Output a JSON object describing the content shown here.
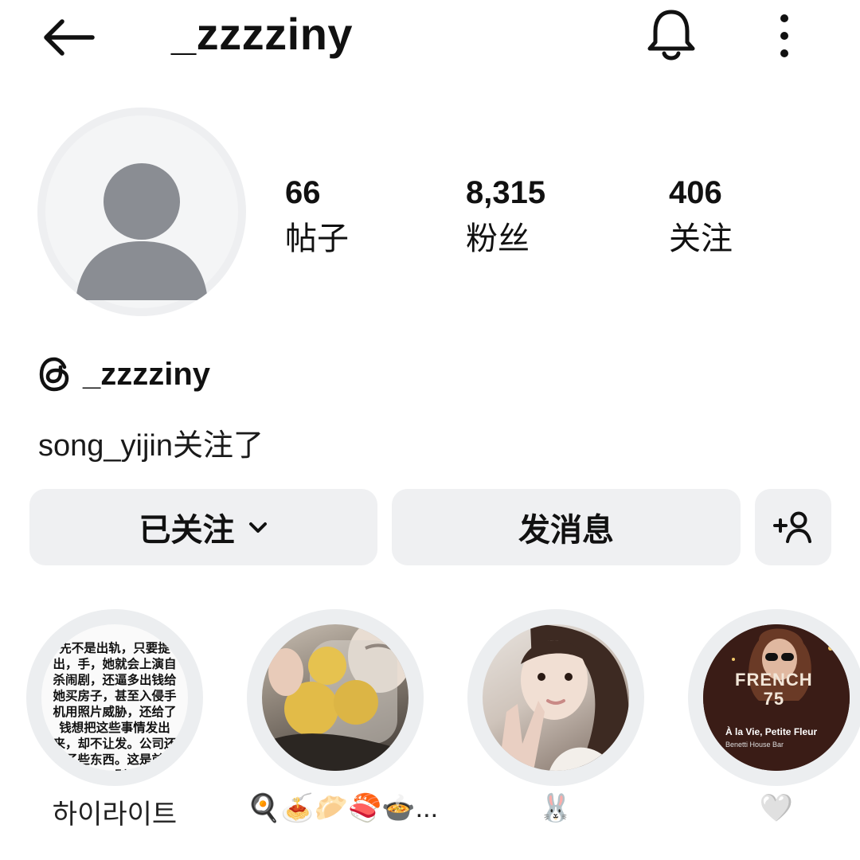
{
  "header": {
    "username": "_zzzziny",
    "back_icon": "arrow-left-icon",
    "bell_icon": "bell-icon",
    "more_icon": "more-vertical-icon"
  },
  "stats": {
    "posts": {
      "value": "66",
      "label": "帖子"
    },
    "followers": {
      "value": "8,315",
      "label": "粉丝"
    },
    "following": {
      "value": "406",
      "label": "关注"
    }
  },
  "threads": {
    "handle": "_zzzziny",
    "icon": "threads-icon"
  },
  "followed_by_text": "song_yijin关注了",
  "actions": {
    "following_label": "已关注",
    "message_label": "发消息",
    "add_user_icon": "add-user-icon"
  },
  "highlights": [
    {
      "caption": "하이라이트",
      "cover_text": "先不是出轨，只要提出，手，她就会上演自杀闹剧，还逼多出钱给她买房子，甚至入侵手机用照片威胁，还给了钱想把这些事情发出来，却不让发。公司还删了些东西。这是前女友的事情。别再对我性骚扰的话或者侮辱人的话。"
    },
    {
      "caption": "🍳🍝🥟🍣🍲..."
    },
    {
      "caption": "🐰"
    },
    {
      "caption": "🤍",
      "cover_title": "FRENCH\n75",
      "cover_song": "À la Vie, Petite Fleur",
      "cover_artist": "Benetti House Bar"
    }
  ]
}
